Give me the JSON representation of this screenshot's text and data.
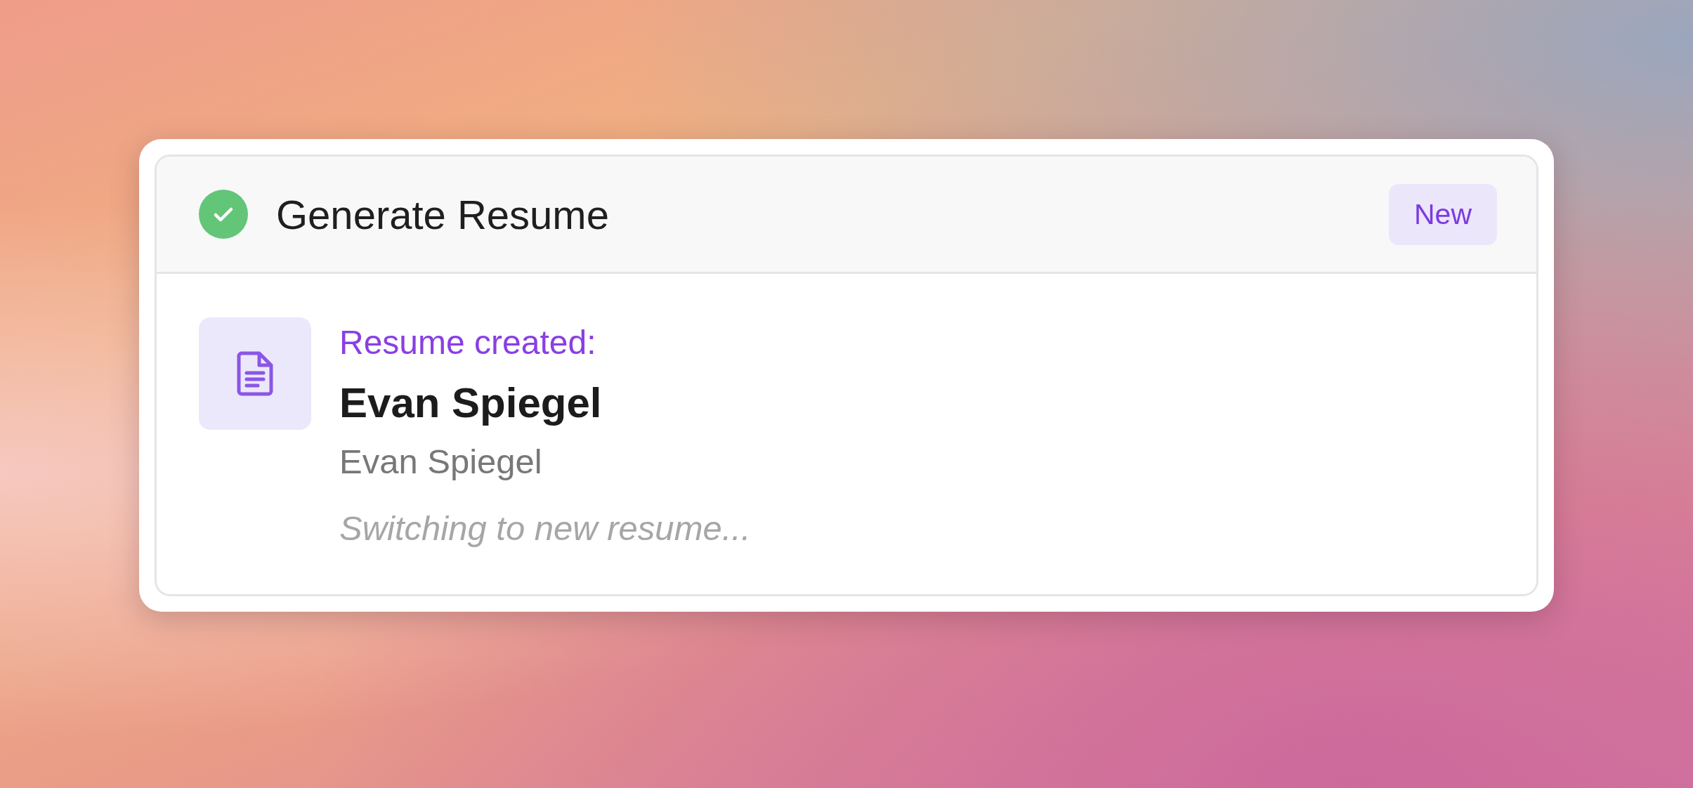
{
  "card": {
    "completed": true,
    "title": "Generate Resume",
    "badge": "New",
    "result": {
      "label": "Resume created:",
      "name": "Evan Spiegel",
      "subtitle": "Evan Spiegel",
      "status_text": "Switching to new resume..."
    }
  }
}
